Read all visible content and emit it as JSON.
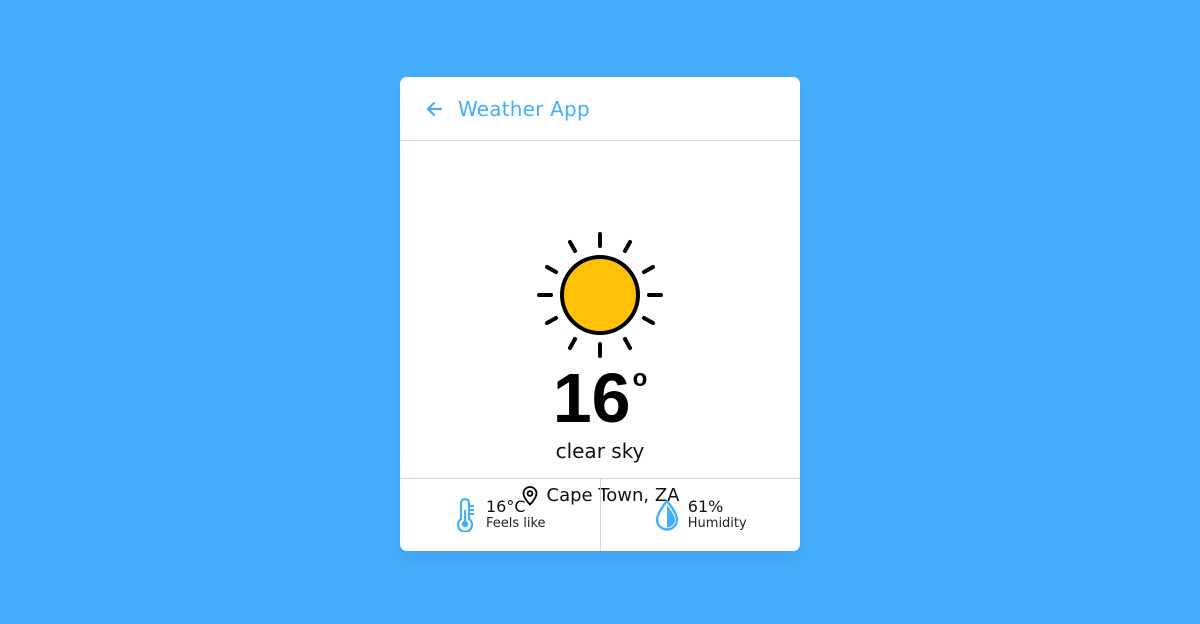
{
  "header": {
    "title": "Weather App",
    "back_icon": "arrow-left-icon"
  },
  "weather": {
    "icon": "sun-icon",
    "temperature": "16",
    "degree_symbol": "o",
    "description": "clear sky",
    "location_icon": "map-pin-icon",
    "location": "Cape Town, ZA"
  },
  "stats": {
    "feels_like": {
      "icon": "thermometer-icon",
      "value": "16°C",
      "label": "Feels like"
    },
    "humidity": {
      "icon": "water-drop-icon",
      "value": "61%",
      "label": "Humidity"
    }
  },
  "colors": {
    "background": "#45aefc",
    "accent": "#45aefc",
    "sun": "#ffc107"
  }
}
